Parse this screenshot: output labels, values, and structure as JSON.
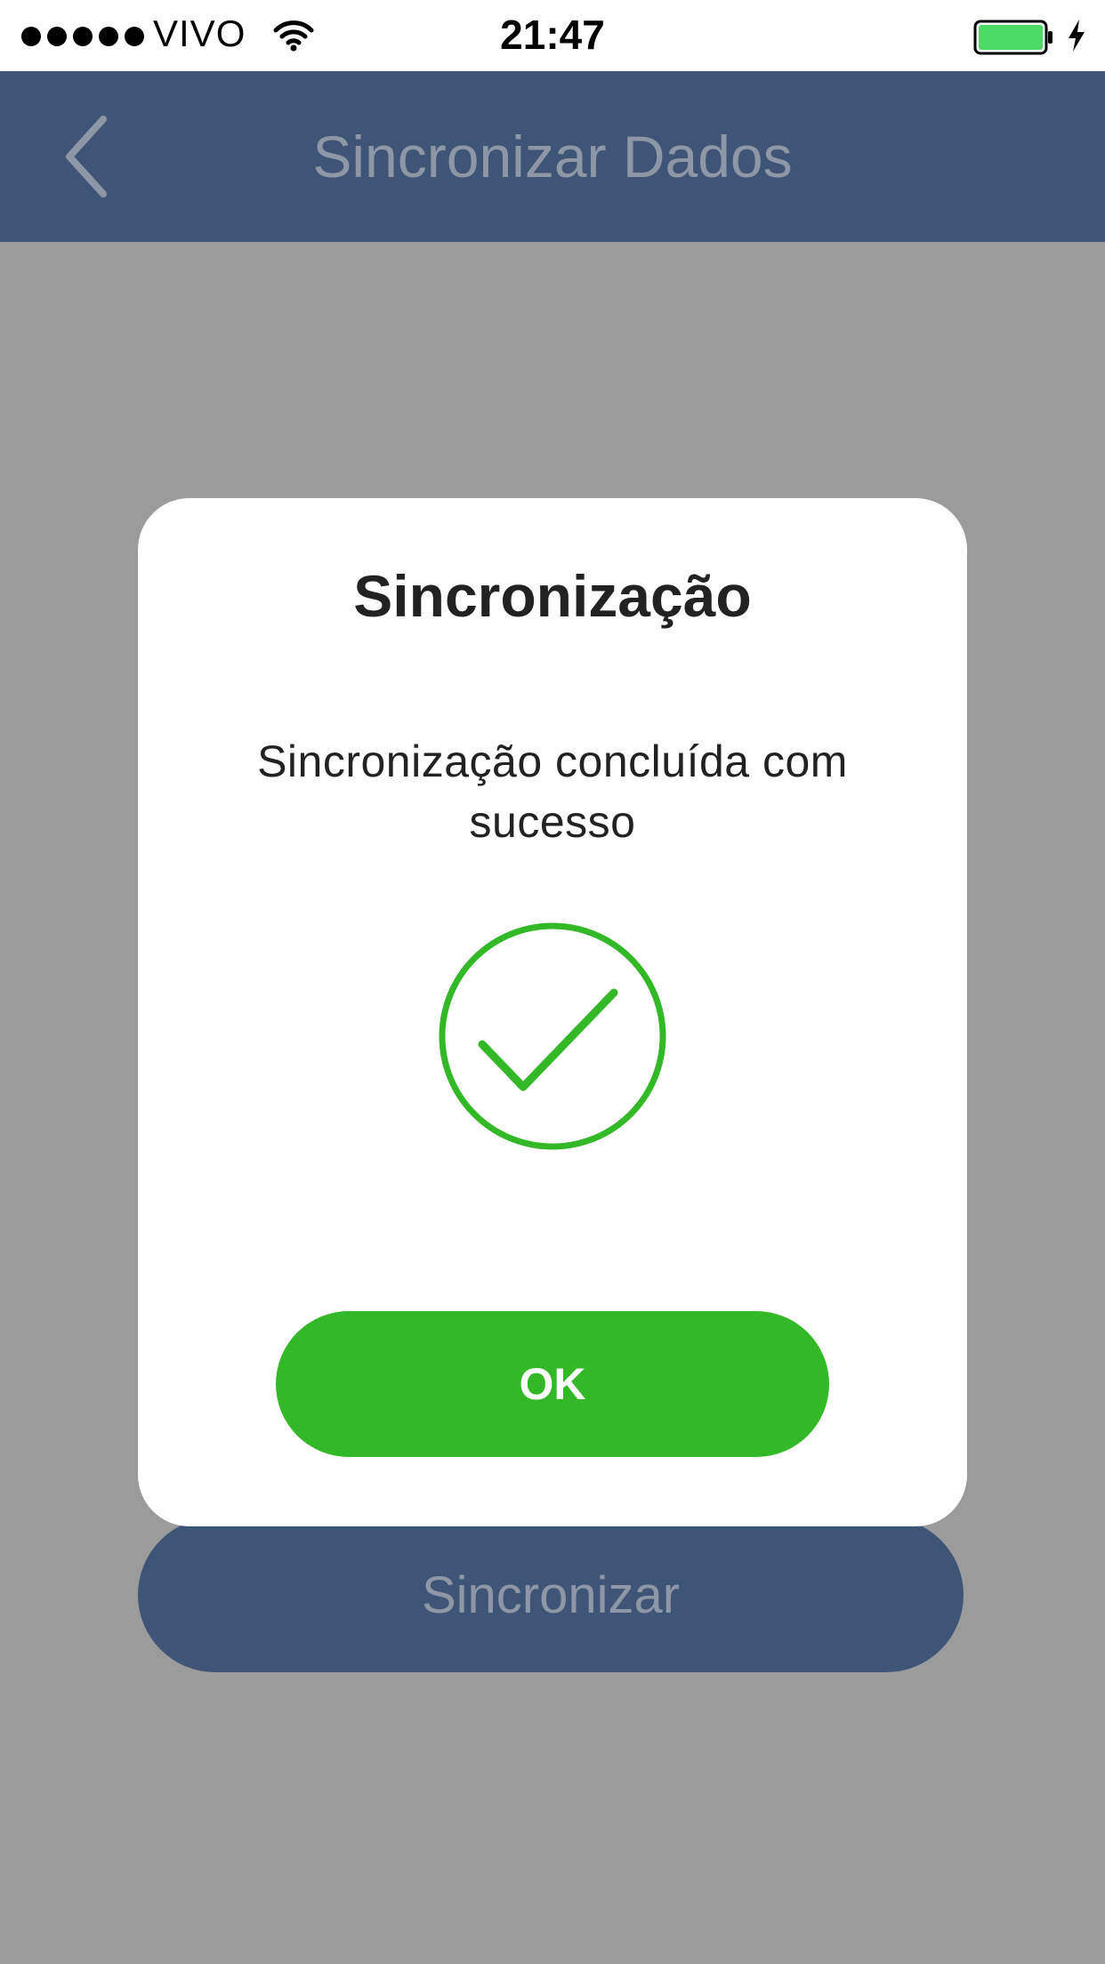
{
  "status_bar": {
    "carrier": "VIVO",
    "time": "21:47",
    "signal_icon": "signal-dots-icon",
    "wifi_icon": "wifi-icon",
    "battery_icon": "battery-icon",
    "charging_icon": "charging-bolt-icon",
    "battery_color": "#4cd964"
  },
  "nav": {
    "title": "Sincronizar Dados",
    "back_icon": "chevron-left-icon",
    "color": "#3f5578"
  },
  "main": {
    "sync_button_label": "Sincronizar"
  },
  "modal": {
    "title": "Sincronização",
    "message": "Sincronização concluída com sucesso",
    "status_icon": "check-circle-icon",
    "ok_label": "OK",
    "accent_color": "#33b828"
  }
}
